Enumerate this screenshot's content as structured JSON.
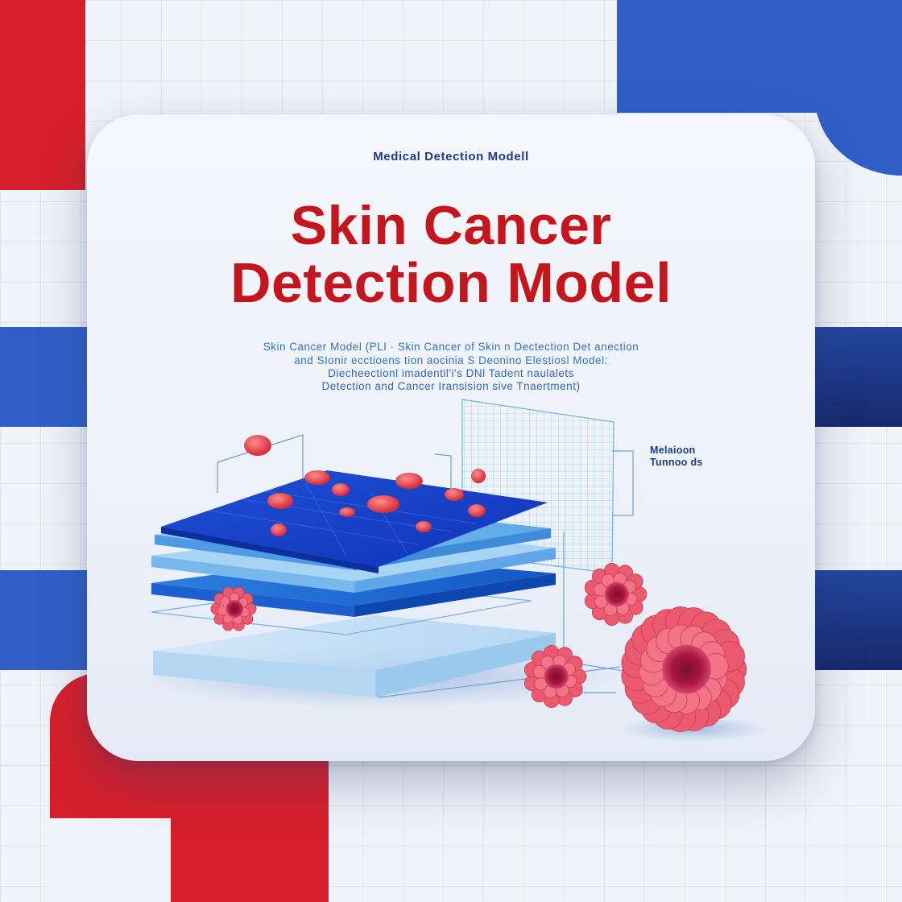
{
  "poster": {
    "eyebrow": "Medical Detection Modell",
    "title_line1": "Skin Cancer",
    "title_line2": "Detection Model",
    "description_lines": [
      "Skin Cancer Model (PLI · Skin Cancer of Skin n Dectection Det anection",
      "and SIonir ecctioens tion aocinia S Deonino Elestiosl Model:",
      "Diecheectionl imadentil'i's DNl Tadent naulalets",
      "Detection and Cancer Iransision sive Tnaertment)"
    ],
    "callout_line1": "Melaioon",
    "callout_line2": "Tunnoo ds"
  },
  "colors": {
    "accent_red": "#c4161c",
    "accent_blue": "#2f5fc6",
    "navy": "#1c3a8a",
    "text_blue": "#2f73c8"
  },
  "icons": [
    "skin-layer-stack-icon",
    "measurement-grid-icon",
    "tumor-cell-icon",
    "cell-droplet-icon"
  ]
}
